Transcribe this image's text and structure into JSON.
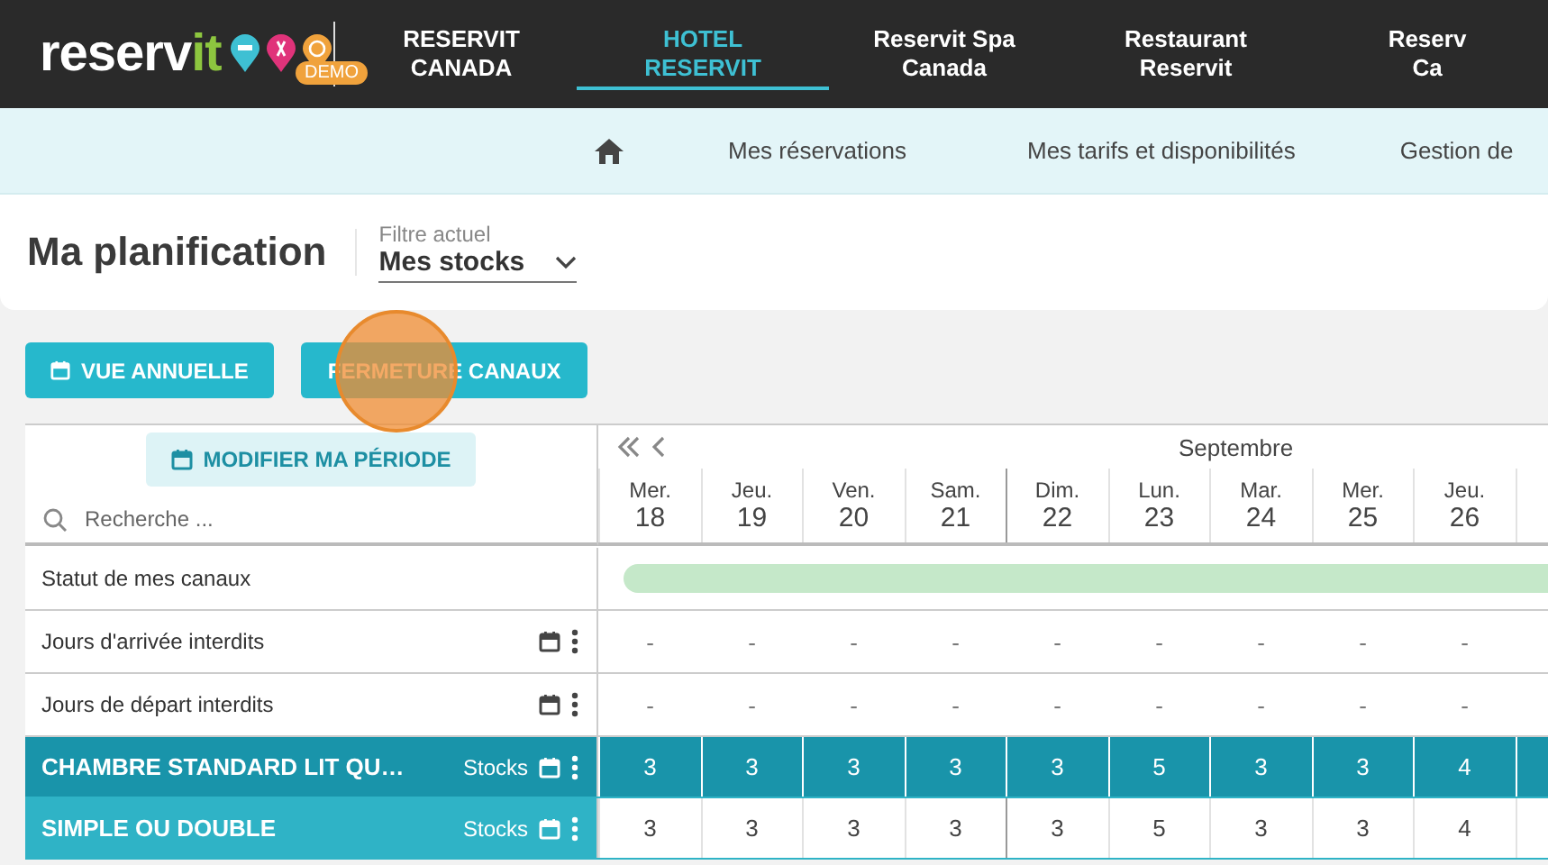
{
  "logo": {
    "text_main": "reserv",
    "text_accent": "it",
    "badge": "DEMO"
  },
  "nav": [
    {
      "lines": [
        "RESERVIT",
        "CANADA"
      ],
      "selected": false
    },
    {
      "lines": [
        "HOTEL",
        "RESERVIT"
      ],
      "selected": true
    },
    {
      "lines": [
        "Reservit Spa",
        "Canada"
      ],
      "selected": false
    },
    {
      "lines": [
        "Restaurant",
        "Reservit"
      ],
      "selected": false
    },
    {
      "lines": [
        "Reserv",
        "Ca"
      ],
      "selected": false
    }
  ],
  "subnav": [
    {
      "kind": "home"
    },
    {
      "kind": "link",
      "label": "Mes réservations"
    },
    {
      "kind": "link",
      "label": "Mes tarifs et disponibilités"
    },
    {
      "kind": "link",
      "label": "Gestion de"
    }
  ],
  "page": {
    "title": "Ma planification",
    "filter_label": "Filtre actuel",
    "filter_value": "Mes stocks"
  },
  "actions": [
    {
      "label": "VUE ANNUELLE",
      "kind": "calendar"
    },
    {
      "label": "FERMETURE CANAUX",
      "kind": "plain"
    }
  ],
  "planning": {
    "period_button": "MODIFIER MA PÉRIODE",
    "search_placeholder": "Recherche ...",
    "month": "Septembre",
    "days": [
      {
        "weekday": "Mer.",
        "day": "18",
        "week_start": false
      },
      {
        "weekday": "Jeu.",
        "day": "19",
        "week_start": false
      },
      {
        "weekday": "Ven.",
        "day": "20",
        "week_start": false
      },
      {
        "weekday": "Sam.",
        "day": "21",
        "week_start": false
      },
      {
        "weekday": "Dim.",
        "day": "22",
        "week_start": true
      },
      {
        "weekday": "Lun.",
        "day": "23",
        "week_start": false
      },
      {
        "weekday": "Mar.",
        "day": "24",
        "week_start": false
      },
      {
        "weekday": "Mer.",
        "day": "25",
        "week_start": false
      },
      {
        "weekday": "Jeu.",
        "day": "26",
        "week_start": false
      }
    ],
    "rows": [
      {
        "kind": "status",
        "label": "Statut de mes canaux"
      },
      {
        "kind": "restriction",
        "label": "Jours d'arrivée interdits",
        "values": [
          "-",
          "-",
          "-",
          "-",
          "-",
          "-",
          "-",
          "-",
          "-"
        ]
      },
      {
        "kind": "restriction",
        "label": "Jours de départ interdits",
        "values": [
          "-",
          "-",
          "-",
          "-",
          "-",
          "-",
          "-",
          "-",
          "-"
        ]
      },
      {
        "kind": "room",
        "label": "CHAMBRE STANDARD LIT QU…",
        "unit": "Stocks",
        "values": [
          "3",
          "3",
          "3",
          "3",
          "3",
          "5",
          "3",
          "3",
          "4"
        ]
      },
      {
        "kind": "rate",
        "label": "SIMPLE OU DOUBLE",
        "unit": "Stocks",
        "values": [
          "3",
          "3",
          "3",
          "3",
          "3",
          "5",
          "3",
          "3",
          "4"
        ]
      }
    ]
  }
}
